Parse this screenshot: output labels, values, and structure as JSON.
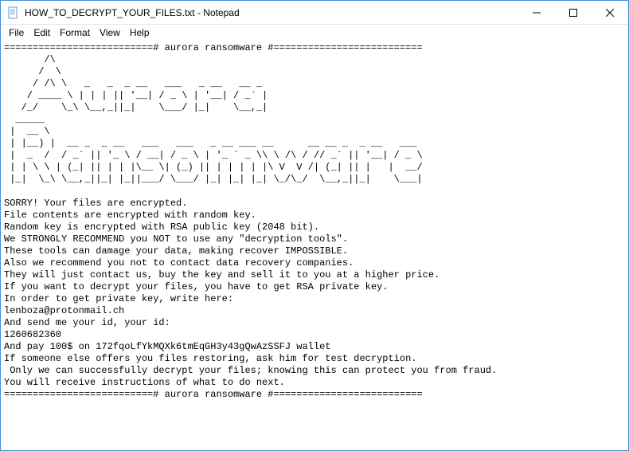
{
  "titlebar": {
    "title": "HOW_TO_DECRYPT_YOUR_FILES.txt - Notepad"
  },
  "menu": {
    "file": "File",
    "edit": "Edit",
    "format": "Format",
    "view": "View",
    "help": "Help"
  },
  "content": {
    "text": "==========================# aurora ransomware #==========================\n       /\\\n      /  \\\n     / /\\ \\   _   _  _ __   ___   _ __   __ _\n    / ____ \\ | | | || '__| / _ \\ | '__| / _` |\n   /_/    \\_\\ \\__,_||_|    \\___/ |_|    \\__,_|\n  _____                                                                         \n |  __ \\                                                                        \n | |__) |  __ _  _ __   ___   ___   _ __ ___ __      __ __ _  _ __   ___        \n |  _  /  / _` || '_ \\ / __| / _ \\ | '_ ` _ \\\\ \\ /\\ / // _` || '__| / _ \\       \n | | \\ \\ | (_| || | | |\\__ \\| (_) || | | | | |\\ V  V /| (_| || |   |  __/       \n |_|  \\_\\ \\__,_||_| |_||___/ \\___/ |_| |_| |_| \\_/\\_/  \\__,_||_|    \\___|       \n\nSORRY! Your files are encrypted.\nFile contents are encrypted with random key.\nRandom key is encrypted with RSA public key (2048 bit).\nWe STRONGLY RECOMMEND you NOT to use any \"decryption tools\".\nThese tools can damage your data, making recover IMPOSSIBLE.\nAlso we recommend you not to contact data recovery companies.\nThey will just contact us, buy the key and sell it to you at a higher price.\nIf you want to decrypt your files, you have to get RSA private key.\nIn order to get private key, write here:\nlenboza@protonmail.ch\nAnd send me your id, your id:\n1260682360\nAnd pay 100$ on 172fqoLfYkMQXk6tmEqGH3y43gQwAzSSFJ wallet\nIf someone else offers you files restoring, ask him for test decryption.\n Only we can successfully decrypt your files; knowing this can protect you from fraud.\nYou will receive instructions of what to do next.\n==========================# aurora ransomware #=========================="
  }
}
